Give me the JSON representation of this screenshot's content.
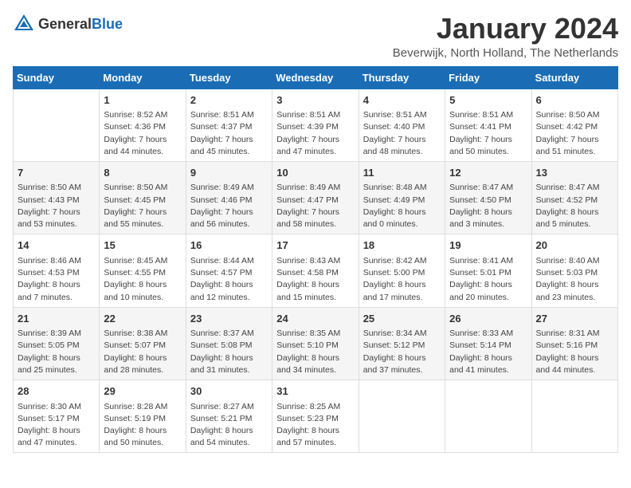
{
  "header": {
    "logo_general": "General",
    "logo_blue": "Blue",
    "month_title": "January 2024",
    "location": "Beverwijk, North Holland, The Netherlands"
  },
  "days_of_week": [
    "Sunday",
    "Monday",
    "Tuesday",
    "Wednesday",
    "Thursday",
    "Friday",
    "Saturday"
  ],
  "weeks": [
    [
      {
        "day": "",
        "sunrise": "",
        "sunset": "",
        "daylight": ""
      },
      {
        "day": "1",
        "sunrise": "Sunrise: 8:52 AM",
        "sunset": "Sunset: 4:36 PM",
        "daylight": "Daylight: 7 hours and 44 minutes."
      },
      {
        "day": "2",
        "sunrise": "Sunrise: 8:51 AM",
        "sunset": "Sunset: 4:37 PM",
        "daylight": "Daylight: 7 hours and 45 minutes."
      },
      {
        "day": "3",
        "sunrise": "Sunrise: 8:51 AM",
        "sunset": "Sunset: 4:39 PM",
        "daylight": "Daylight: 7 hours and 47 minutes."
      },
      {
        "day": "4",
        "sunrise": "Sunrise: 8:51 AM",
        "sunset": "Sunset: 4:40 PM",
        "daylight": "Daylight: 7 hours and 48 minutes."
      },
      {
        "day": "5",
        "sunrise": "Sunrise: 8:51 AM",
        "sunset": "Sunset: 4:41 PM",
        "daylight": "Daylight: 7 hours and 50 minutes."
      },
      {
        "day": "6",
        "sunrise": "Sunrise: 8:50 AM",
        "sunset": "Sunset: 4:42 PM",
        "daylight": "Daylight: 7 hours and 51 minutes."
      }
    ],
    [
      {
        "day": "7",
        "sunrise": "Sunrise: 8:50 AM",
        "sunset": "Sunset: 4:43 PM",
        "daylight": "Daylight: 7 hours and 53 minutes."
      },
      {
        "day": "8",
        "sunrise": "Sunrise: 8:50 AM",
        "sunset": "Sunset: 4:45 PM",
        "daylight": "Daylight: 7 hours and 55 minutes."
      },
      {
        "day": "9",
        "sunrise": "Sunrise: 8:49 AM",
        "sunset": "Sunset: 4:46 PM",
        "daylight": "Daylight: 7 hours and 56 minutes."
      },
      {
        "day": "10",
        "sunrise": "Sunrise: 8:49 AM",
        "sunset": "Sunset: 4:47 PM",
        "daylight": "Daylight: 7 hours and 58 minutes."
      },
      {
        "day": "11",
        "sunrise": "Sunrise: 8:48 AM",
        "sunset": "Sunset: 4:49 PM",
        "daylight": "Daylight: 8 hours and 0 minutes."
      },
      {
        "day": "12",
        "sunrise": "Sunrise: 8:47 AM",
        "sunset": "Sunset: 4:50 PM",
        "daylight": "Daylight: 8 hours and 3 minutes."
      },
      {
        "day": "13",
        "sunrise": "Sunrise: 8:47 AM",
        "sunset": "Sunset: 4:52 PM",
        "daylight": "Daylight: 8 hours and 5 minutes."
      }
    ],
    [
      {
        "day": "14",
        "sunrise": "Sunrise: 8:46 AM",
        "sunset": "Sunset: 4:53 PM",
        "daylight": "Daylight: 8 hours and 7 minutes."
      },
      {
        "day": "15",
        "sunrise": "Sunrise: 8:45 AM",
        "sunset": "Sunset: 4:55 PM",
        "daylight": "Daylight: 8 hours and 10 minutes."
      },
      {
        "day": "16",
        "sunrise": "Sunrise: 8:44 AM",
        "sunset": "Sunset: 4:57 PM",
        "daylight": "Daylight: 8 hours and 12 minutes."
      },
      {
        "day": "17",
        "sunrise": "Sunrise: 8:43 AM",
        "sunset": "Sunset: 4:58 PM",
        "daylight": "Daylight: 8 hours and 15 minutes."
      },
      {
        "day": "18",
        "sunrise": "Sunrise: 8:42 AM",
        "sunset": "Sunset: 5:00 PM",
        "daylight": "Daylight: 8 hours and 17 minutes."
      },
      {
        "day": "19",
        "sunrise": "Sunrise: 8:41 AM",
        "sunset": "Sunset: 5:01 PM",
        "daylight": "Daylight: 8 hours and 20 minutes."
      },
      {
        "day": "20",
        "sunrise": "Sunrise: 8:40 AM",
        "sunset": "Sunset: 5:03 PM",
        "daylight": "Daylight: 8 hours and 23 minutes."
      }
    ],
    [
      {
        "day": "21",
        "sunrise": "Sunrise: 8:39 AM",
        "sunset": "Sunset: 5:05 PM",
        "daylight": "Daylight: 8 hours and 25 minutes."
      },
      {
        "day": "22",
        "sunrise": "Sunrise: 8:38 AM",
        "sunset": "Sunset: 5:07 PM",
        "daylight": "Daylight: 8 hours and 28 minutes."
      },
      {
        "day": "23",
        "sunrise": "Sunrise: 8:37 AM",
        "sunset": "Sunset: 5:08 PM",
        "daylight": "Daylight: 8 hours and 31 minutes."
      },
      {
        "day": "24",
        "sunrise": "Sunrise: 8:35 AM",
        "sunset": "Sunset: 5:10 PM",
        "daylight": "Daylight: 8 hours and 34 minutes."
      },
      {
        "day": "25",
        "sunrise": "Sunrise: 8:34 AM",
        "sunset": "Sunset: 5:12 PM",
        "daylight": "Daylight: 8 hours and 37 minutes."
      },
      {
        "day": "26",
        "sunrise": "Sunrise: 8:33 AM",
        "sunset": "Sunset: 5:14 PM",
        "daylight": "Daylight: 8 hours and 41 minutes."
      },
      {
        "day": "27",
        "sunrise": "Sunrise: 8:31 AM",
        "sunset": "Sunset: 5:16 PM",
        "daylight": "Daylight: 8 hours and 44 minutes."
      }
    ],
    [
      {
        "day": "28",
        "sunrise": "Sunrise: 8:30 AM",
        "sunset": "Sunset: 5:17 PM",
        "daylight": "Daylight: 8 hours and 47 minutes."
      },
      {
        "day": "29",
        "sunrise": "Sunrise: 8:28 AM",
        "sunset": "Sunset: 5:19 PM",
        "daylight": "Daylight: 8 hours and 50 minutes."
      },
      {
        "day": "30",
        "sunrise": "Sunrise: 8:27 AM",
        "sunset": "Sunset: 5:21 PM",
        "daylight": "Daylight: 8 hours and 54 minutes."
      },
      {
        "day": "31",
        "sunrise": "Sunrise: 8:25 AM",
        "sunset": "Sunset: 5:23 PM",
        "daylight": "Daylight: 8 hours and 57 minutes."
      },
      {
        "day": "",
        "sunrise": "",
        "sunset": "",
        "daylight": ""
      },
      {
        "day": "",
        "sunrise": "",
        "sunset": "",
        "daylight": ""
      },
      {
        "day": "",
        "sunrise": "",
        "sunset": "",
        "daylight": ""
      }
    ]
  ]
}
